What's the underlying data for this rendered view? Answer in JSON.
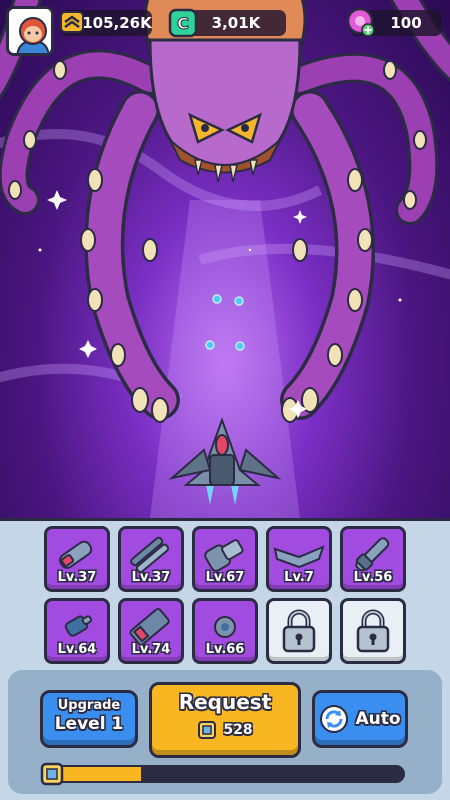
{
  "hud": {
    "gold": "105,26K",
    "cash": "3,01K",
    "gems": "100",
    "gold_icon": "stacked-chevrons-icon",
    "cash_icon": "c-coin-icon",
    "gems_icon": "pink-gem-plus-icon"
  },
  "weapons": [
    {
      "level": "Lv.37",
      "icon": "rocket-pod-icon"
    },
    {
      "level": "Lv.37",
      "icon": "twin-barrel-icon"
    },
    {
      "level": "Lv.67",
      "icon": "gatling-icon"
    },
    {
      "level": "Lv.7",
      "icon": "wing-icon"
    },
    {
      "level": "Lv.56",
      "icon": "cannon-icon"
    },
    {
      "level": "Lv.64",
      "icon": "small-turret-icon"
    },
    {
      "level": "Lv.74",
      "icon": "missile-launcher-icon"
    },
    {
      "level": "Lv.66",
      "icon": "orb-turret-icon"
    },
    {
      "level": "",
      "icon": "lock-icon"
    },
    {
      "level": "",
      "icon": "lock-icon"
    }
  ],
  "upgrade": {
    "title": "Upgrade",
    "level": "Level 1"
  },
  "request": {
    "title": "Request",
    "cost": "528",
    "cost_icon": "crate-icon"
  },
  "auto": {
    "label": "Auto",
    "icon": "refresh-icon"
  },
  "progress": {
    "fraction": 0.27
  },
  "colors": {
    "slot_purple": "#a24be0",
    "button_blue": "#3a8ef0",
    "button_gold": "#f8b721",
    "panel_bg": "#c5d6e6",
    "outline": "#2b2b44"
  }
}
